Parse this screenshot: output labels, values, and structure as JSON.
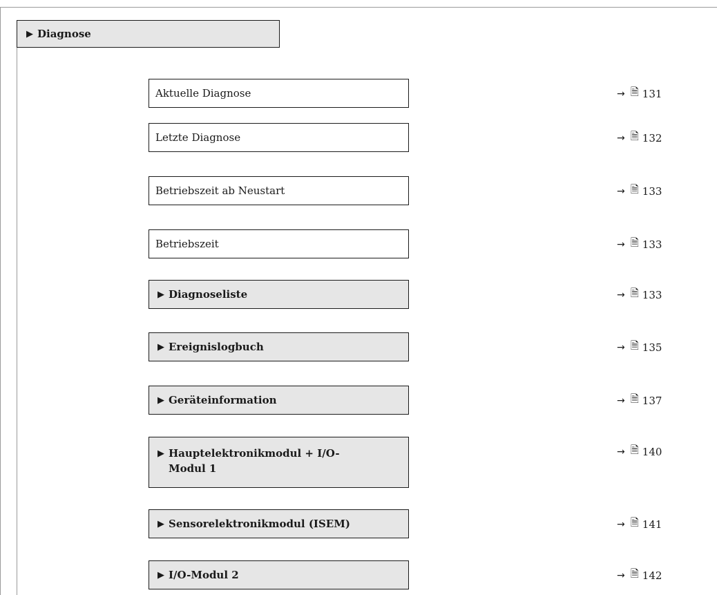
{
  "root": {
    "label": "Diagnose"
  },
  "items": [
    {
      "label": "Aktuelle Diagnose",
      "page": "131"
    },
    {
      "label": "Letzte Diagnose",
      "page": "132"
    },
    {
      "label": "Betriebszeit ab Neustart",
      "page": "133"
    },
    {
      "label": "Betriebszeit",
      "page": "133"
    },
    {
      "label": "Diagnoseliste",
      "page": "133"
    },
    {
      "label": "Ereignislogbuch",
      "page": "135"
    },
    {
      "label": "Geräteinformation",
      "page": "137"
    },
    {
      "label": "Hauptelektronikmodul + I/O-Modul 1",
      "line1": "Hauptelektronikmodul + I/O-",
      "line2": "Modul 1",
      "page": "140"
    },
    {
      "label": "Sensorelektronikmodul (ISEM)",
      "page": "141"
    },
    {
      "label": "I/O-Modul 2",
      "page": "142"
    }
  ],
  "symbols": {
    "submenu_marker": "▶",
    "arrow": "→",
    "page_ref": "🗎"
  }
}
